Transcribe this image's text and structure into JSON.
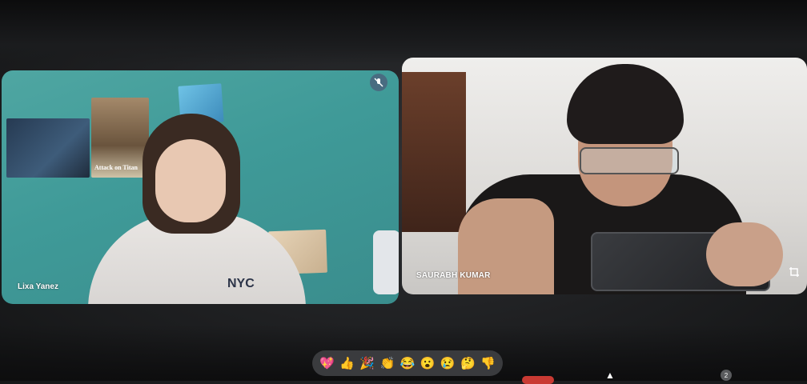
{
  "participants": [
    {
      "name": "Lixa Yanez"
    },
    {
      "name": "SAURABH KUMAR"
    }
  ],
  "left_tile": {
    "poster_text": "Attack on Titan",
    "shirt_text": "NYC",
    "mute_icon": "mic-off-icon"
  },
  "right_tile": {
    "corner_icon": "crop-expand-icon"
  },
  "reactions": [
    "💖",
    "👍",
    "🎉",
    "👏",
    "😂",
    "😮",
    "😢",
    "🤔",
    "👎"
  ],
  "badge_count": "2",
  "colors": {
    "left_wall": "#3f9a98",
    "reaction_bar_bg": "#3a3b3e",
    "leave_button": "#c93a33"
  }
}
